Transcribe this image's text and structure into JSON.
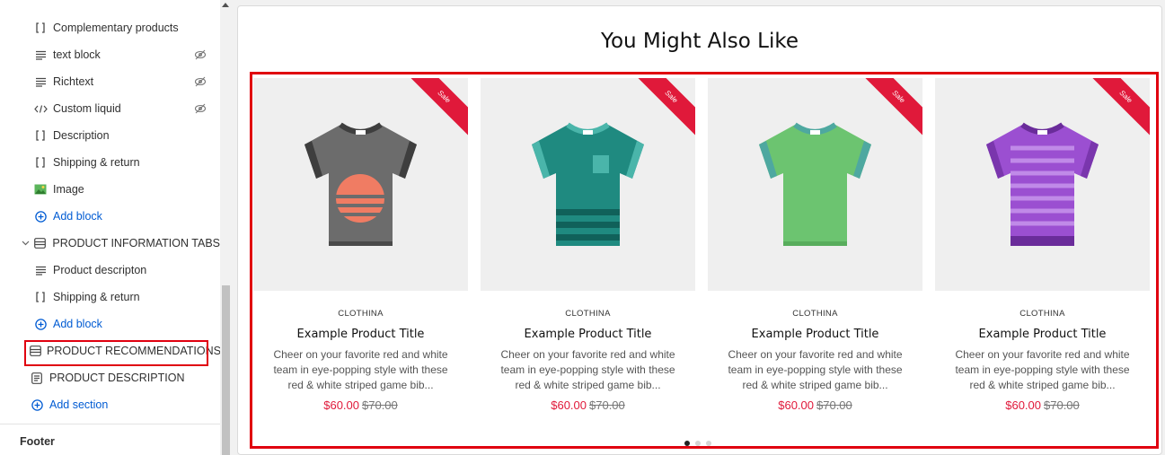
{
  "sidebar": {
    "items": [
      {
        "label": "Complementary products",
        "icon": "block-bracket-icon",
        "hidden": false
      },
      {
        "label": "text block",
        "icon": "text-lines-icon",
        "hidden": true
      },
      {
        "label": "Richtext",
        "icon": "text-lines-icon",
        "hidden": true
      },
      {
        "label": "Custom liquid",
        "icon": "code-icon",
        "hidden": true
      },
      {
        "label": "Description",
        "icon": "block-bracket-icon",
        "hidden": false
      },
      {
        "label": "Shipping & return",
        "icon": "block-bracket-icon",
        "hidden": false
      },
      {
        "label": "Image",
        "icon": "image-icon",
        "hidden": false
      }
    ],
    "add_block_1": "Add block",
    "section_tabs": "PRODUCT INFORMATION TABS",
    "tab_items": [
      {
        "label": "Product descripton",
        "icon": "text-lines-icon"
      },
      {
        "label": "Shipping & return",
        "icon": "block-bracket-icon"
      }
    ],
    "add_block_2": "Add block",
    "section_recommendations": "PRODUCT RECOMMENDATIONS",
    "section_description": "PRODUCT DESCRIPTION",
    "add_section": "Add section",
    "footer": "Footer"
  },
  "preview": {
    "heading": "You Might Also Like",
    "sale_badge": "Sale",
    "products": [
      {
        "vendor": "CLOTHINA",
        "title": "Example Product Title",
        "description": "Cheer on your favorite red and white team in eye-popping style with these red & white striped game bib...",
        "price": "$60.00",
        "compare_price": "$70.00",
        "shirt": "grey"
      },
      {
        "vendor": "CLOTHINA",
        "title": "Example Product Title",
        "description": "Cheer on your favorite red and white team in eye-popping style with these red & white striped game bib...",
        "price": "$60.00",
        "compare_price": "$70.00",
        "shirt": "teal"
      },
      {
        "vendor": "CLOTHINA",
        "title": "Example Product Title",
        "description": "Cheer on your favorite red and white team in eye-popping style with these red & white striped game bib...",
        "price": "$60.00",
        "compare_price": "$70.00",
        "shirt": "green"
      },
      {
        "vendor": "CLOTHINA",
        "title": "Example Product Title",
        "description": "Cheer on your favorite red and white team in eye-popping style with these red & white striped game bib...",
        "price": "$60.00",
        "compare_price": "$70.00",
        "shirt": "purple"
      }
    ],
    "pagination": {
      "total": 3,
      "active": 1
    }
  },
  "colors": {
    "highlight": "#e0000f",
    "link": "#005bd3",
    "sale": "#e0193a",
    "price": "#e0193a"
  }
}
